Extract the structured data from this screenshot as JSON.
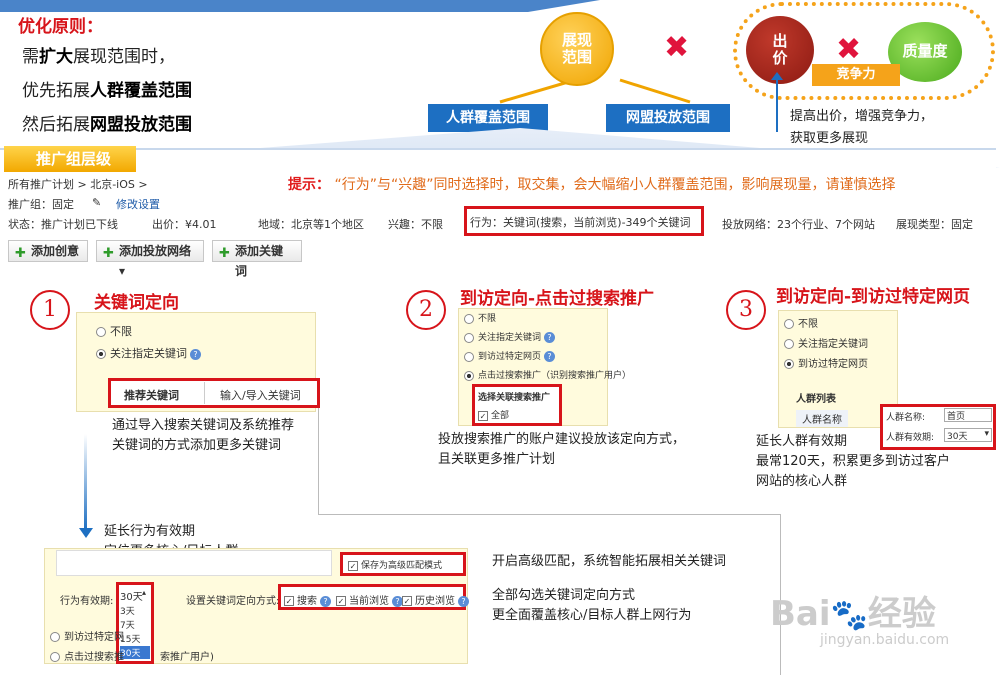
{
  "principle": {
    "title": "优化原则：",
    "line1_a": "需",
    "line1_b": "扩大",
    "line1_c": "展现范围时，",
    "line2_a": "优先拓展",
    "line2_b": "人群覆盖范围",
    "line3_a": "然后拓展",
    "line3_b": "网盟投放范围"
  },
  "diagram": {
    "show_range": "展现\n范围",
    "crowd_range": "人群覆盖范围",
    "network_range": "网盟投放范围",
    "bid": "出\n价",
    "quality": "质量度",
    "competition": "竞争力",
    "cross": "✖",
    "note_line1": "提高出价，增强竞争力，",
    "note_line2": "获取更多展现"
  },
  "panel": {
    "tab_label": "推广组层级",
    "breadcrumb": "所有推广计划 > 北京-iOS >",
    "hint_prefix": "提示：",
    "hint_text": "“行为”与“兴趣”同时选择时，取交集，会大幅缩小人群覆盖范围，影响展现量，请谨慎选择",
    "group_label": "推广组：固定",
    "edit_settings": "修改设置",
    "status": "状态：推广计划已下线",
    "bid": "出价：¥4.01",
    "region": "地域：北京等1个地区",
    "interest": "兴趣：不限",
    "behavior": "行为：关键词(搜索，当前浏览)-349个关键词",
    "network": "投放网络：23个行业、7个网站",
    "display_type": "展现类型：固定",
    "buttons": {
      "add_creative": "添加创意",
      "add_network": "添加投放网络",
      "add_keyword": "添加关键词"
    }
  },
  "sections": {
    "s1": {
      "num": "1",
      "title": "关键词定向",
      "opt_none": "不限",
      "opt_keyword": "关注指定关键词",
      "tab_recommend": "推荐关键词",
      "tab_import": "输入/导入关键词",
      "desc1": "通过导入搜索关键词及系统推荐",
      "desc2": "关键词的方式添加更多关键词"
    },
    "s2": {
      "num": "2",
      "title": "到访定向-点击过搜索推广",
      "opt_none": "不限",
      "opt_keyword": "关注指定关键词",
      "opt_visit": "到访过特定网页",
      "opt_click": "点击过搜索推广（识别搜索推广用户）",
      "choose": "选择关联搜索推广",
      "all": "全部",
      "desc1": "投放搜索推广的账户建议投放该定向方式，",
      "desc2": "且关联更多推广计划"
    },
    "s3": {
      "num": "3",
      "title": "到访定向-到访过特定网页",
      "opt_none": "不限",
      "opt_keyword": "关注指定关键词",
      "opt_visit": "到访过特定网页",
      "crowd_list": "人群列表",
      "crowd_name_col": "人群名称",
      "name_label": "人群名称:",
      "name_value": "首页",
      "valid_label": "人群有效期:",
      "valid_value": "30天",
      "desc1": "延长人群有效期",
      "desc2": "最常120天，积累更多到访过客户",
      "desc3": "网站的核心人群"
    },
    "bottom": {
      "extend1": "延长行为有效期",
      "extend2": "定位更多核心/目标人群",
      "save_advanced": "保存为高级匹配模式",
      "validity_label": "行为有效期:",
      "validity_value": "30天",
      "validity_options": [
        "3天",
        "7天",
        "15天",
        "30天"
      ],
      "set_mode": "设置关键词定向方式:",
      "mode_search": "搜索",
      "mode_browse": "当前浏览",
      "mode_history": "历史浏览",
      "opt_visit": "到访过特定网",
      "opt_click": "点击过搜索推",
      "opt_click_tail": "索推广用户)",
      "advanced_desc": "开启高级匹配，系统智能拓展相关关键词",
      "all_desc1": "全部勾选关键词定向方式",
      "all_desc2": "更全面覆盖核心/目标人群上网行为"
    }
  },
  "watermark": {
    "brand": "Bai",
    "brand2": "经验",
    "url": "jingyan.baidu.com"
  }
}
